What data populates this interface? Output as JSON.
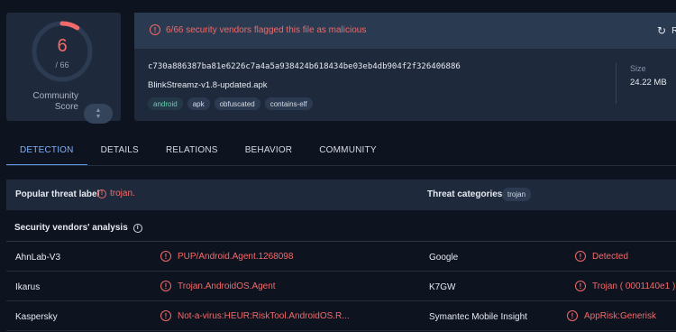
{
  "score": {
    "detections": "6",
    "total": "/ 66",
    "ratio": 0.0909,
    "ring_color": "#f26a6a",
    "community_label_line1": "Community",
    "community_label_line2": "Score",
    "community_badge_icon": "up-down-arrows-icon"
  },
  "alert": {
    "icon": "alert-circle-icon",
    "text": "6/66 security vendors flagged this file as malicious",
    "reanalyze_icon": "refresh-icon",
    "reanalyze_label": "R"
  },
  "file": {
    "hash": "c730a886387ba81e6226c7a4a5a938424b618434be03eb4db904f2f326406886",
    "name": "BlinkStreamz-v1.8-updated.apk",
    "tags": [
      "android",
      "apk",
      "obfuscated",
      "contains-elf"
    ],
    "size_label": "Size",
    "size_value": "24.22 MB"
  },
  "tabs": [
    "DETECTION",
    "DETAILS",
    "RELATIONS",
    "BEHAVIOR",
    "COMMUNITY"
  ],
  "active_tab": "DETECTION",
  "threat": {
    "label": "Popular threat label",
    "value": "trojan.",
    "categories_label": "Threat categories",
    "category": "trojan"
  },
  "vendors": {
    "title": "Security vendors' analysis",
    "rows": [
      {
        "left_vendor": "AhnLab-V3",
        "left_result": "PUP/Android.Agent.1268098",
        "right_vendor": "Google",
        "right_result": "Detected"
      },
      {
        "left_vendor": "Ikarus",
        "left_result": "Trojan.AndroidOS.Agent",
        "right_vendor": "K7GW",
        "right_result": "Trojan ( 0001140e1 )"
      },
      {
        "left_vendor": "Kaspersky",
        "left_result": "Not-a-virus:HEUR:RiskTool.AndroidOS.R...",
        "right_vendor": "Symantec Mobile Insight",
        "right_result": "AppRisk:Generisk"
      }
    ]
  },
  "colors": {
    "danger": "#f26a6a",
    "accent": "#5f97ea",
    "background": "#0e1320",
    "card": "#1e2a3c"
  }
}
